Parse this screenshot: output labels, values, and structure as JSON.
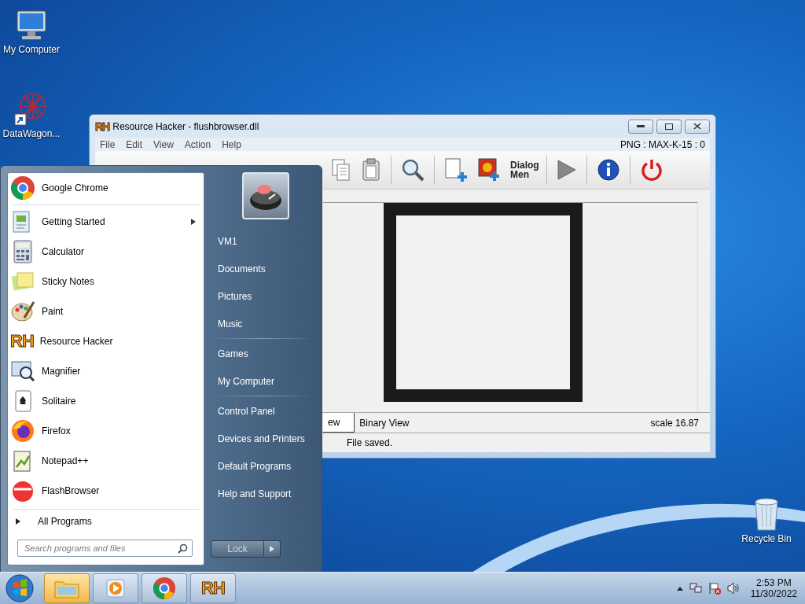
{
  "desktop_icons": [
    {
      "label": "My Computer"
    },
    {
      "label": "DataWagon..."
    },
    {
      "label": "Recycle Bin"
    }
  ],
  "window": {
    "icon_text": "RH",
    "title": "Resource Hacker - flushbrowser.dll",
    "menu": [
      "File",
      "Edit",
      "View",
      "Action",
      "Help"
    ],
    "info": "PNG : MAX-K-15 : 0",
    "toolbar_label": "Dialog Men",
    "tabs": [
      {
        "label": "ew",
        "selected": true
      },
      {
        "label": "Binary View",
        "selected": false
      }
    ],
    "scale": "scale 16.87",
    "status": "File saved."
  },
  "start_menu": {
    "pinned": [
      {
        "label": "Google Chrome",
        "submenu": false
      }
    ],
    "programs": [
      {
        "label": "Getting Started",
        "submenu": true
      },
      {
        "label": "Calculator",
        "submenu": false
      },
      {
        "label": "Sticky Notes",
        "submenu": false
      },
      {
        "label": "Paint",
        "submenu": false
      },
      {
        "label": "Resource Hacker",
        "submenu": false,
        "icon_text": "RH"
      },
      {
        "label": "Magnifier",
        "submenu": false
      },
      {
        "label": "Solitaire",
        "submenu": false
      },
      {
        "label": "Firefox",
        "submenu": false
      },
      {
        "label": "Notepad++",
        "submenu": false
      },
      {
        "label": "FlashBrowser",
        "submenu": false
      }
    ],
    "all_programs": "All Programs",
    "search": {
      "placeholder": "Search programs and files"
    },
    "places": [
      [
        "VM1",
        "Documents",
        "Pictures",
        "Music"
      ],
      [
        "Games",
        "My Computer"
      ],
      [
        "Control Panel",
        "Devices and Printers",
        "Default Programs",
        "Help and Support"
      ]
    ],
    "lock": "Lock"
  },
  "taskbar": {
    "buttons": [
      {
        "highlighted": true
      },
      {
        "highlighted": false
      },
      {
        "highlighted": false
      },
      {
        "highlighted": false,
        "icon_text": "RH"
      }
    ],
    "time": "2:53 PM",
    "date": "11/30/2022"
  }
}
